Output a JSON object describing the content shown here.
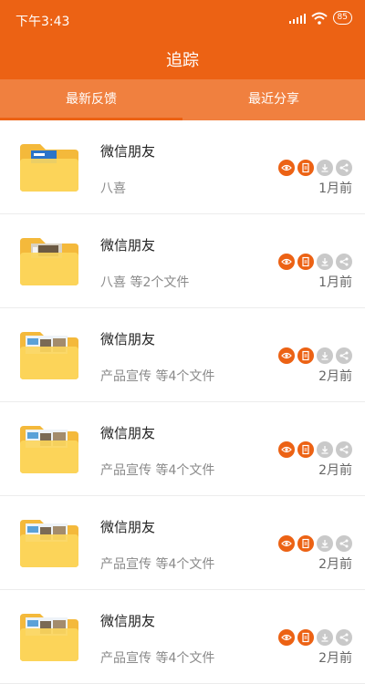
{
  "status": {
    "time": "下午3:43",
    "battery": "85"
  },
  "header": {
    "title": "追踪"
  },
  "tabs": [
    {
      "label": "最新反馈"
    },
    {
      "label": "最近分享"
    }
  ],
  "colors": {
    "accent": "#ec6214",
    "tab_bg": "#f0803f"
  },
  "items": [
    {
      "title": "微信朋友",
      "subtitle": "八喜",
      "time": "1月前",
      "thumb": "label"
    },
    {
      "title": "微信朋友",
      "subtitle": "八喜 等2个文件",
      "time": "1月前",
      "thumb": "photo"
    },
    {
      "title": "微信朋友",
      "subtitle": "产品宣传 等4个文件",
      "time": "2月前",
      "thumb": "promo"
    },
    {
      "title": "微信朋友",
      "subtitle": "产品宣传 等4个文件",
      "time": "2月前",
      "thumb": "promo"
    },
    {
      "title": "微信朋友",
      "subtitle": "产品宣传 等4个文件",
      "time": "2月前",
      "thumb": "promo"
    },
    {
      "title": "微信朋友",
      "subtitle": "产品宣传 等4个文件",
      "time": "2月前",
      "thumb": "promo"
    }
  ],
  "action_icons": [
    "eye-icon",
    "document-icon",
    "download-icon",
    "share-icon"
  ]
}
